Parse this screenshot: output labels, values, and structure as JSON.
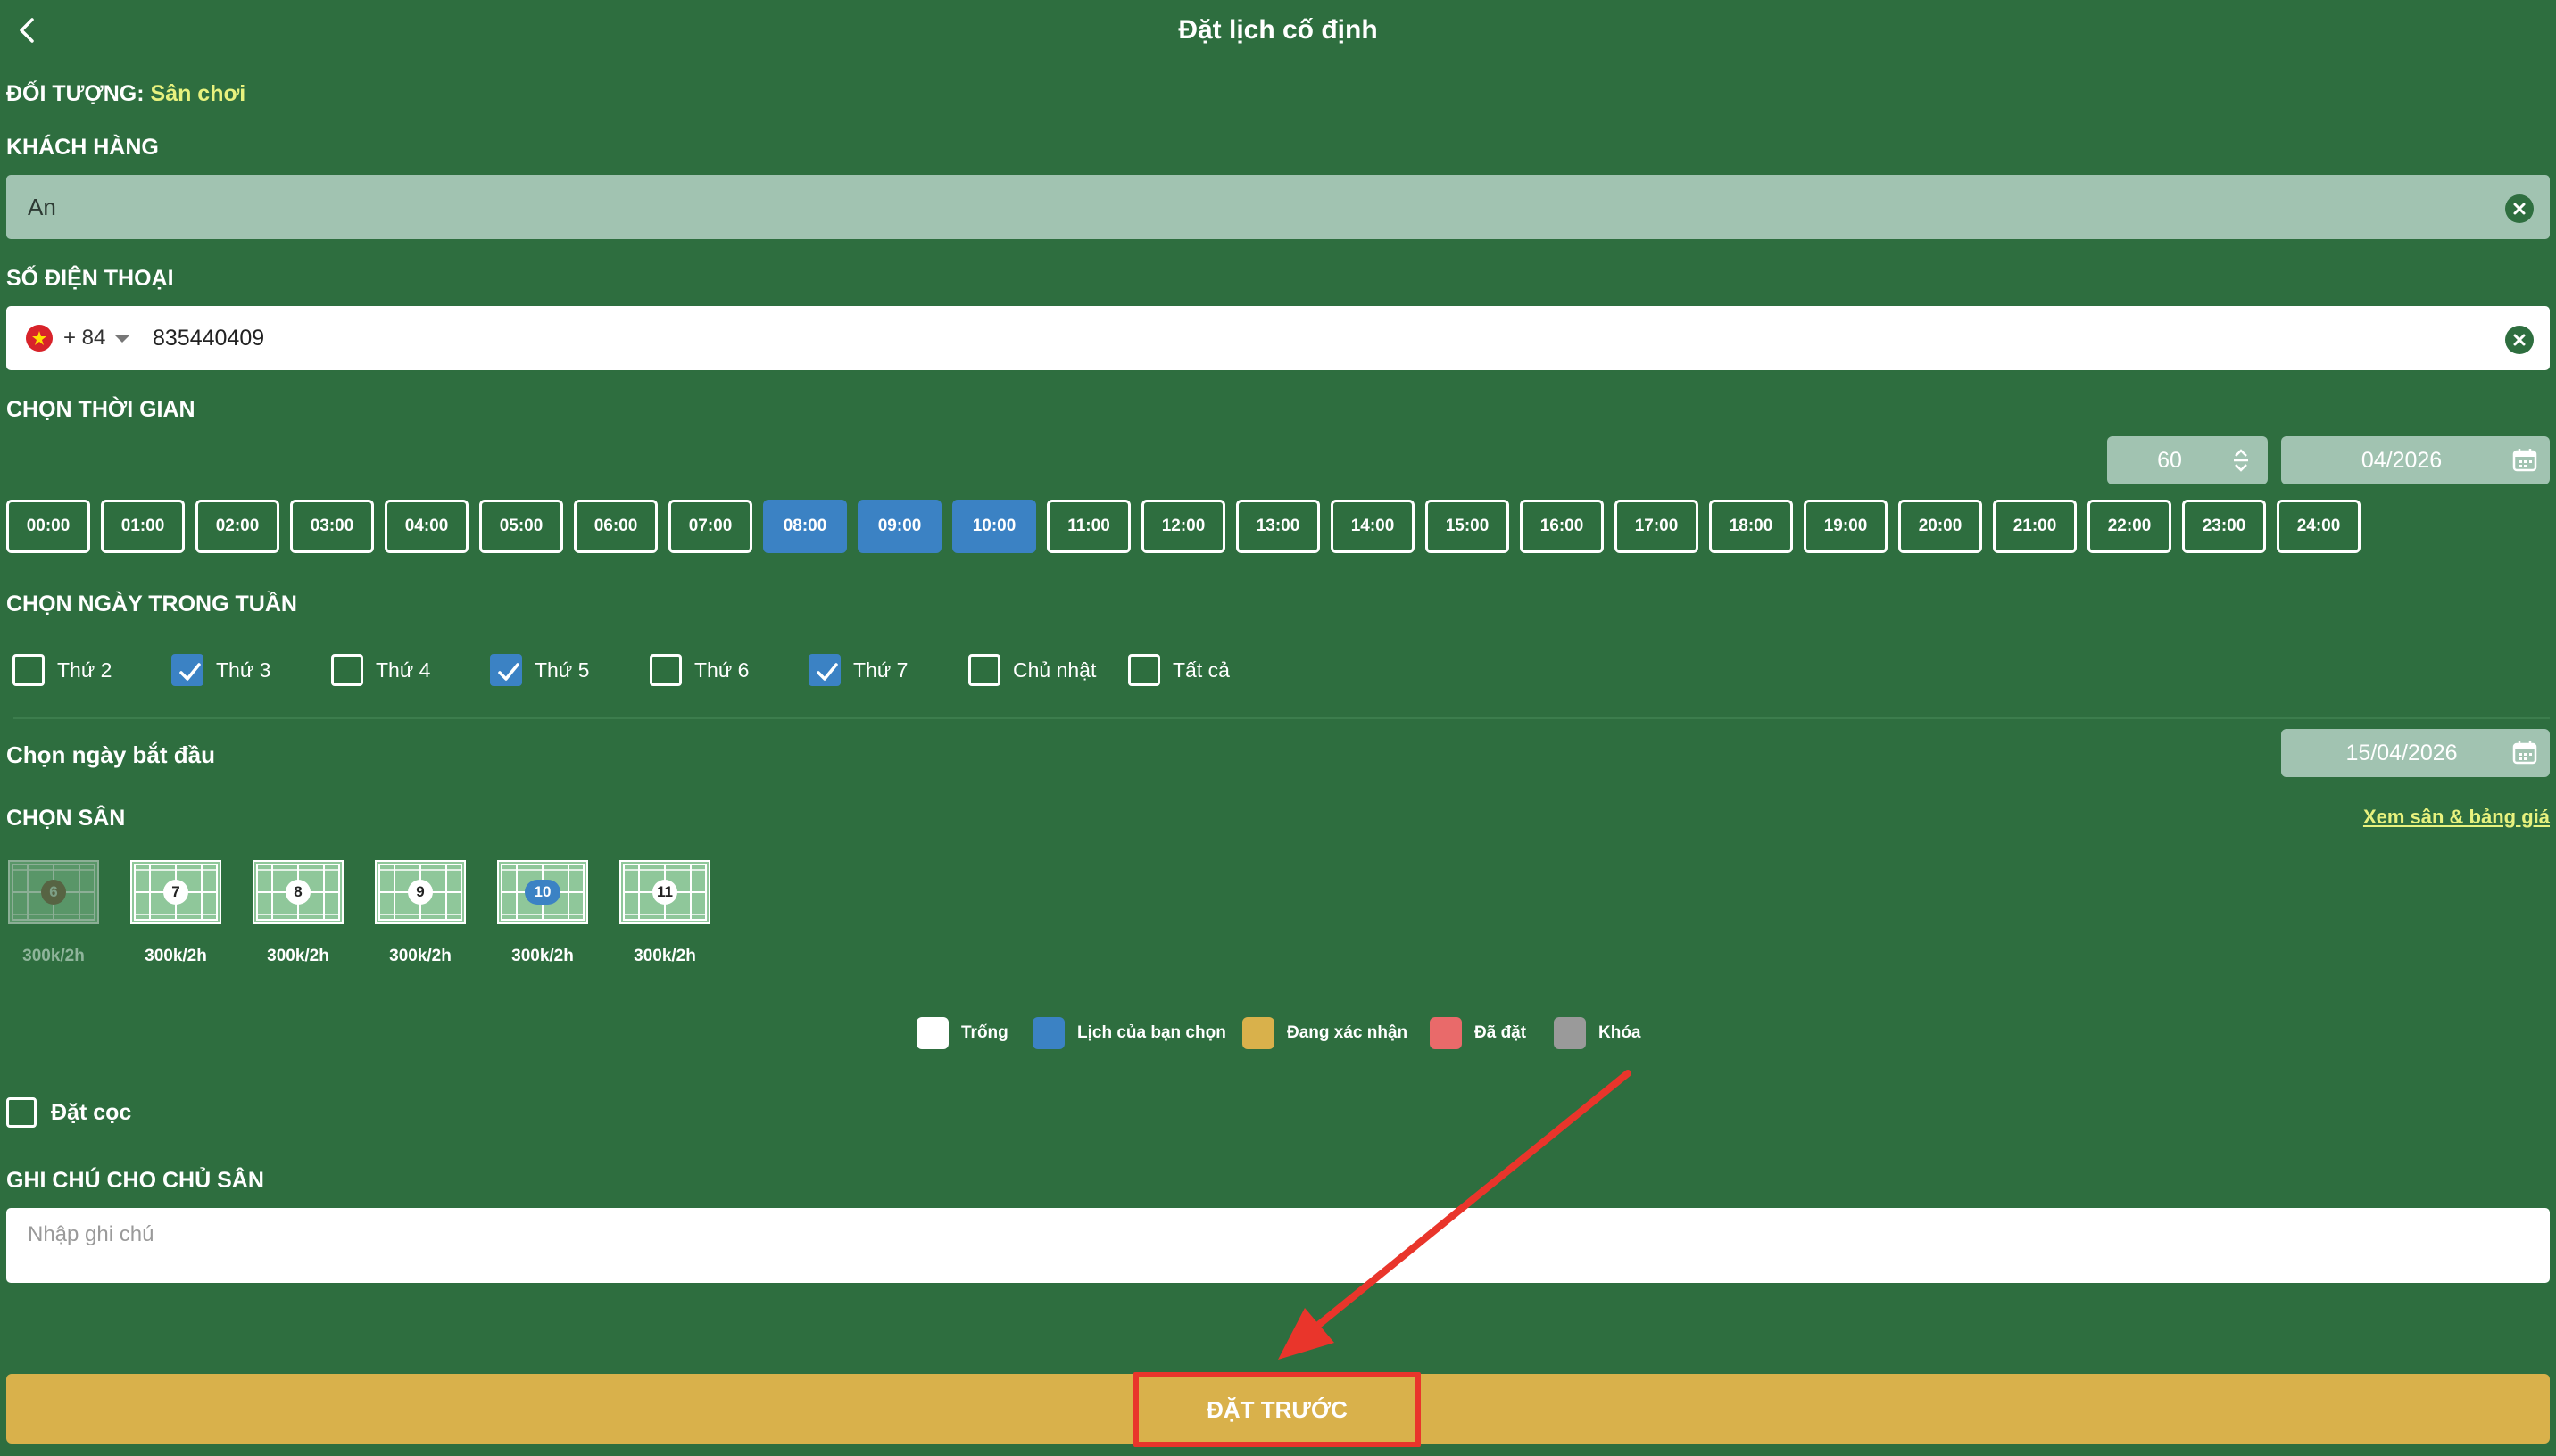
{
  "header": {
    "title": "Đặt lịch cố định"
  },
  "target": {
    "label": "ĐỐI TƯỢNG:",
    "value": "Sân chơi"
  },
  "customer": {
    "label": "KHÁCH HÀNG",
    "value": "An"
  },
  "phone": {
    "label": "SỐ ĐIỆN THOẠI",
    "country_code": "+ 84",
    "value": "835440409"
  },
  "time": {
    "label": "CHỌN THỜI GIAN",
    "duration": "60",
    "month": "04/2026",
    "slots": [
      "00:00",
      "01:00",
      "02:00",
      "03:00",
      "04:00",
      "05:00",
      "06:00",
      "07:00",
      "08:00",
      "09:00",
      "10:00",
      "11:00",
      "12:00",
      "13:00",
      "14:00",
      "15:00",
      "16:00",
      "17:00",
      "18:00",
      "19:00",
      "20:00",
      "21:00",
      "22:00",
      "23:00",
      "24:00"
    ],
    "selected": [
      "08:00",
      "09:00",
      "10:00"
    ]
  },
  "weekdays": {
    "label": "CHỌN NGÀY TRONG TUẦN",
    "items": [
      {
        "label": "Thứ 2",
        "checked": false
      },
      {
        "label": "Thứ 3",
        "checked": true
      },
      {
        "label": "Thứ 4",
        "checked": false
      },
      {
        "label": "Thứ 5",
        "checked": true
      },
      {
        "label": "Thứ 6",
        "checked": false
      },
      {
        "label": "Thứ 7",
        "checked": true
      },
      {
        "label": "Chủ nhật",
        "checked": false
      },
      {
        "label": "Tất cả",
        "checked": false
      }
    ]
  },
  "start_date": {
    "label": "Chọn ngày bắt đầu",
    "value": "15/04/2026"
  },
  "courts": {
    "label": "CHỌN SÂN",
    "link": "Xem sân & bảng giá",
    "items": [
      {
        "number": "6",
        "price": "300k/2h",
        "state": "locked"
      },
      {
        "number": "7",
        "price": "300k/2h",
        "state": "empty"
      },
      {
        "number": "8",
        "price": "300k/2h",
        "state": "empty"
      },
      {
        "number": "9",
        "price": "300k/2h",
        "state": "empty"
      },
      {
        "number": "10",
        "price": "300k/2h",
        "state": "selected"
      },
      {
        "number": "11",
        "price": "300k/2h",
        "state": "empty"
      }
    ]
  },
  "legend": [
    {
      "label": "Trống",
      "color": "#ffffff"
    },
    {
      "label": "Lịch của bạn chọn",
      "color": "#3b82c4"
    },
    {
      "label": "Đang xác nhận",
      "color": "#d9b14b"
    },
    {
      "label": "Đã đặt",
      "color": "#e96a6a"
    },
    {
      "label": "Khóa",
      "color": "#9a9a9a"
    }
  ],
  "deposit": {
    "label": "Đặt cọc",
    "checked": false
  },
  "note": {
    "label": "GHI CHÚ CHO CHỦ SÂN",
    "placeholder": "Nhập ghi chú"
  },
  "submit": {
    "label": "ĐẶT TRƯỚC"
  }
}
